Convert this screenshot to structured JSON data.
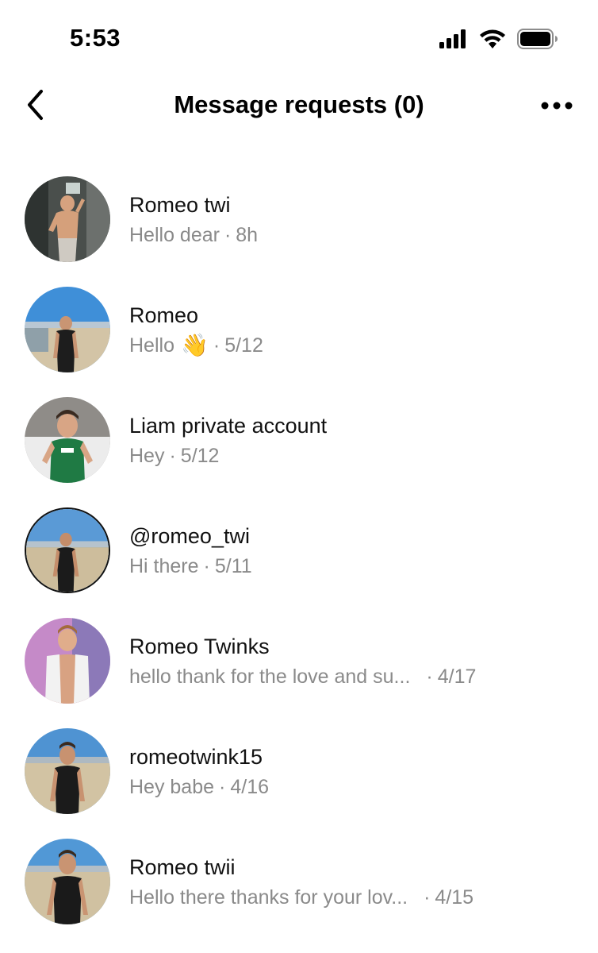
{
  "status_bar": {
    "time": "5:53",
    "icons": [
      "cellular-signal-icon",
      "wifi-icon",
      "battery-icon"
    ]
  },
  "header": {
    "title": "Message requests (0)",
    "back_icon": "chevron-left-icon",
    "more_icon": "more-horizontal-icon"
  },
  "requests": [
    {
      "name": "Romeo twi",
      "preview": "Hello dear",
      "time": "8h"
    },
    {
      "name": "Romeo",
      "preview": "Hello",
      "emoji": "👋",
      "time": "5/12"
    },
    {
      "name": "Liam private account",
      "preview": "Hey",
      "time": "5/12"
    },
    {
      "name": "@romeo_twi",
      "preview": "Hi there",
      "time": "5/11"
    },
    {
      "name": "Romeo Twinks",
      "preview": "hello thank for the love and su...",
      "time": "4/17"
    },
    {
      "name": "romeotwink15",
      "preview": "Hey babe",
      "time": "4/16"
    },
    {
      "name": "Romeo twii",
      "preview": "Hello there thanks for your lov...",
      "time": "4/15"
    }
  ],
  "colors": {
    "text_primary": "#111111",
    "text_secondary": "#8a8a8a",
    "background": "#ffffff"
  }
}
